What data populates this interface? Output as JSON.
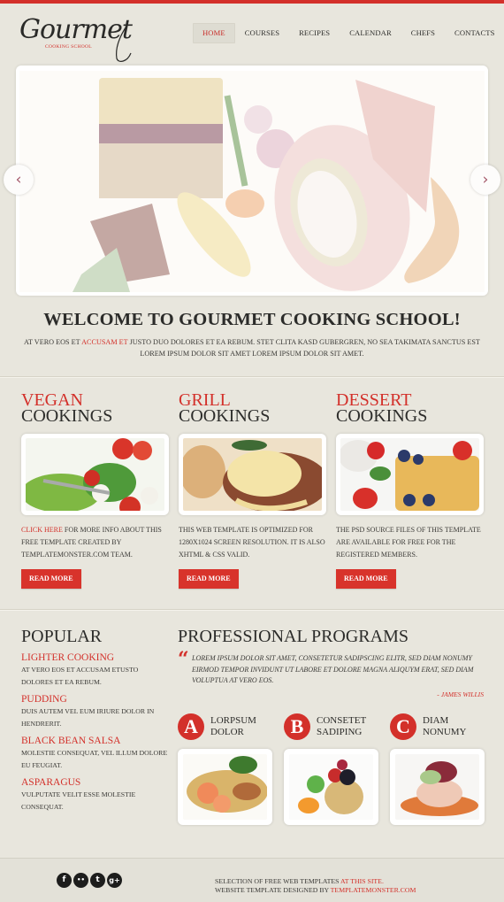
{
  "colors": {
    "accent": "#d3302a",
    "background": "#e8e6dd",
    "text": "#2f2f2d"
  },
  "logo": {
    "script": "Gourmet",
    "subtitle": "COOKING SCHOOL"
  },
  "nav": {
    "items": [
      {
        "label": "HOME",
        "active": true
      },
      {
        "label": "COURSES",
        "active": false
      },
      {
        "label": "RECIPES",
        "active": false
      },
      {
        "label": "CALENDAR",
        "active": false
      },
      {
        "label": "CHEFS",
        "active": false
      },
      {
        "label": "CONTACTS",
        "active": false
      }
    ]
  },
  "slider": {
    "prev_icon": "chevron-left-icon",
    "next_icon": "chevron-right-icon",
    "prev_glyph": "‹",
    "next_glyph": "›",
    "image": "plated-dish-photo"
  },
  "welcome": {
    "title": "WELCOME TO GOURMET COOKING SCHOOL!",
    "text_before": "AT VERO EOS ET ",
    "link": "ACCUSAM ET",
    "text_after": " JUSTO DUO DOLORES ET EA REBUM. STET CLITA KASD GUBERGREN, NO SEA TAKIMATA SANCTUS EST LOREM IPSUM DOLOR SIT AMET LOREM IPSUM DOLOR SIT AMET."
  },
  "cookings": [
    {
      "title_red": "VEGAN",
      "title_dark": "COOKINGS",
      "image": "salad-photo",
      "link": "CLICK HERE",
      "text": " FOR MORE INFO ABOUT THIS FREE TEMPLATE CREATED BY TEMPLATEMONSTER.COM TEAM.",
      "button": "READ MORE"
    },
    {
      "title_red": "GRILL",
      "title_dark": "COOKINGS",
      "image": "grilled-steak-photo",
      "link": "",
      "text": "THIS WEB TEMPLATE IS OPTIMIZED FOR 1280X1024 SCREEN RESOLUTION. IT IS ALSO XHTML & CSS VALID.",
      "button": "READ MORE"
    },
    {
      "title_red": "DESSERT",
      "title_dark": "COOKINGS",
      "image": "waffles-photo",
      "link": "",
      "text": "THE PSD SOURCE FILES OF THIS TEMPLATE ARE AVAILABLE FOR FREE FOR THE REGISTERED MEMBERS.",
      "button": "READ MORE"
    }
  ],
  "popular": {
    "title": "POPULAR",
    "items": [
      {
        "title": "LIGHTER COOKING",
        "text": "AT VERO EOS ET ACCUSAM ETUSTO DOLORES ET EA REBUM."
      },
      {
        "title": "PUDDING",
        "text": "DUIS AUTEM VEL EUM IRIURE DOLOR IN HENDRERIT."
      },
      {
        "title": "BLACK BEAN SALSA",
        "text": "MOLESTIE CONSEQUAT, VEL ILLUM DOLORE EU FEUGIAT."
      },
      {
        "title": "ASPARAGUS",
        "text": "VULPUTATE VELIT ESSE MOLESTIE CONSEQUAT."
      }
    ]
  },
  "programs": {
    "title": "PROFESSIONAL PROGRAMS",
    "quote": "LOREM IPSUM DOLOR SIT AMET, CONSETETUR SADIPSCING ELITR, SED DIAM NONUMY EIRMOD TEMPOR INVIDUNT UT LABORE ET DOLORE MAGNA ALIQUYM ERAT, SED DIAM VOLUPTUA AT VERO EOS.",
    "quote_mark": "“",
    "author": "- JAMES WILLIS",
    "items": [
      {
        "letter": "A",
        "line1": "LORPSUM",
        "line2": "DOLOR",
        "image": "shrimp-omelette-photo"
      },
      {
        "letter": "B",
        "line1": "CONSETET",
        "line2": "SADIPING",
        "image": "fruit-tart-photo"
      },
      {
        "letter": "C",
        "line1": "DIAM",
        "line2": "NONUMY",
        "image": "shrimp-salad-photo"
      }
    ]
  },
  "footer": {
    "social": [
      {
        "name": "facebook",
        "glyph": "f"
      },
      {
        "name": "flickr",
        "glyph": "••"
      },
      {
        "name": "twitter",
        "glyph": "t"
      },
      {
        "name": "google-plus",
        "glyph": "g+"
      }
    ],
    "line1_text": "SELECTION OF FREE WEB TEMPLATES ",
    "line1_link": "AT THIS SITE.",
    "line2_text": "WEBSITE TEMPLATE DESIGNED BY ",
    "line2_link": "TEMPLATEMONSTER.COM"
  }
}
